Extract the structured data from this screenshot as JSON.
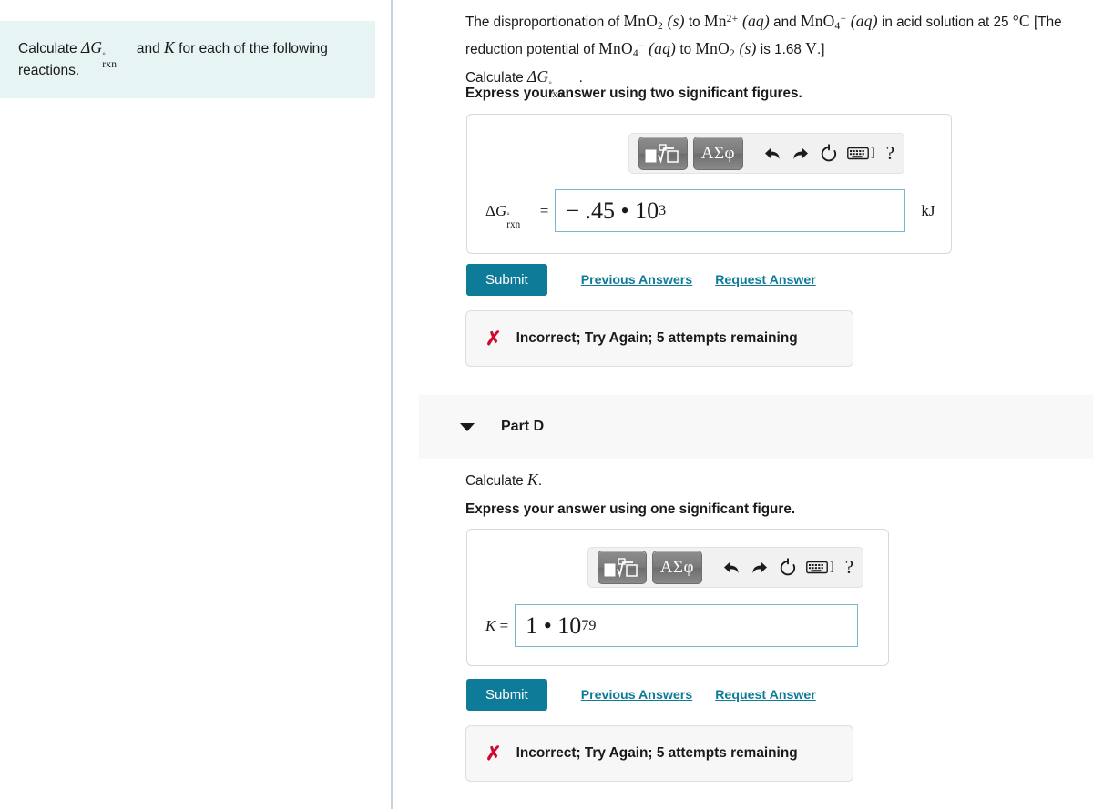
{
  "sidebar": {
    "prompt_line1_pre": "Calculate ",
    "prompt_symbol": "ΔG°rxn",
    "prompt_line1_mid": " and ",
    "prompt_symbol2": "K",
    "prompt_line1_post": " for each of the following reactions."
  },
  "question": {
    "line1": "The disproportionation of MnO2 (s) to Mn2+ (aq) and MnO4− (aq) in acid solution at 25",
    "line2": "°C [The reduction potential of MnO4− (aq) to MnO2 (s) is 1.68 V.]",
    "line3": "Calculate ΔG°rxn.",
    "temperature": "25",
    "potential": "1.68 V",
    "species": [
      "MnO2 (s)",
      "Mn2+ (aq)",
      "MnO4- (aq)"
    ],
    "instruction": "Express your answer using two significant figures."
  },
  "part_c": {
    "field_label": "ΔG°rxn =",
    "value_mantissa": "− .45 • 10",
    "value_exponent": "3",
    "unit": "kJ",
    "submit_label": "Submit",
    "previous_answers_label": "Previous Answers",
    "request_answer_label": "Request Answer",
    "feedback_icon": "✗",
    "feedback_text": "Incorrect; Try Again; 5 attempts remaining"
  },
  "part_d": {
    "title": "Part D",
    "prompt": "Calculate K.",
    "instruction": "Express your answer using one significant figure.",
    "field_label": "K =",
    "value_mantissa": "1 • 10",
    "value_exponent": "79",
    "submit_label": "Submit",
    "previous_answers_label": "Previous Answers",
    "request_answer_label": "Request Answer",
    "feedback_icon": "✗",
    "feedback_text": "Incorrect; Try Again; 5 attempts remaining"
  },
  "toolbar": {
    "template_icon": "math-template-icon",
    "greek_label": "ΑΣφ",
    "undo_icon": "undo-arrow-icon",
    "redo_icon": "redo-arrow-icon",
    "reset_icon": "reset-circle-icon",
    "keyboard_icon": "keyboard-icon",
    "keyboard_bracket": "]",
    "help_label": "?"
  },
  "colors": {
    "accent": "#0e7b99",
    "prompt_bg": "#e6f4f4",
    "error": "#cf0a2c",
    "input_border": "#7cb6cc",
    "panel_bg": "#f8f8f8"
  }
}
